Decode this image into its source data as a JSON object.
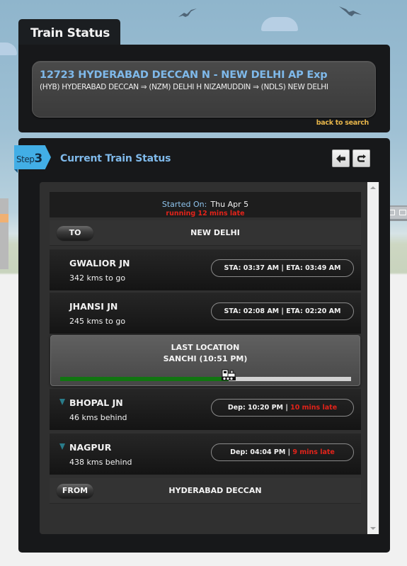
{
  "page": {
    "tab_title": "Train Status",
    "back_to_search": "back to search"
  },
  "train": {
    "name": "12723 HYDERABAD DECCAN N - NEW DELHI AP Exp",
    "route": "(HYB) HYDERABAD DECCAN ⇒ (NZM) DELHI H NIZAMUDDIN ⇒ (NDLS) NEW DELHI"
  },
  "section": {
    "step_label": "Step",
    "step_number": "3",
    "title": "Current Train Status",
    "buttons": [
      {
        "name": "back-button",
        "icon": "arrow-left-icon",
        "glyph": "🡄"
      },
      {
        "name": "refresh-button",
        "icon": "refresh-icon",
        "glyph": "↻"
      }
    ]
  },
  "status": {
    "started_label": "Started On:",
    "started_value": "Thu Apr 5",
    "late_text": "running 12 mins late"
  },
  "to": {
    "label": "TO",
    "station": "NEW DELHI"
  },
  "upcoming": [
    {
      "station": "GWALIOR JN",
      "distance": "342 kms to go",
      "times": "STA: 03:37 AM | ETA: 03:49 AM"
    },
    {
      "station": "JHANSI JN",
      "distance": "245 kms to go",
      "times": "STA: 02:08 AM | ETA: 02:20 AM"
    }
  ],
  "last_location": {
    "heading": "LAST LOCATION",
    "place": "SANCHI (10:51 PM)",
    "progress_percent": 58
  },
  "passed": [
    {
      "station": "BHOPAL JN",
      "distance": "46 kms behind",
      "dep": "Dep: 10:20 PM | ",
      "late": "10 mins late"
    },
    {
      "station": "NAGPUR",
      "distance": "438 kms behind",
      "dep": "Dep: 04:04 PM | ",
      "late": "9 mins late"
    }
  ],
  "from": {
    "label": "FROM",
    "station": "HYDERABAD DECCAN"
  },
  "colors": {
    "accent_blue": "#7fb9ea",
    "late_red": "#e2231a",
    "progress_green": "#117511",
    "link_gold": "#e7b54a",
    "step_badge": "#42aee6"
  }
}
